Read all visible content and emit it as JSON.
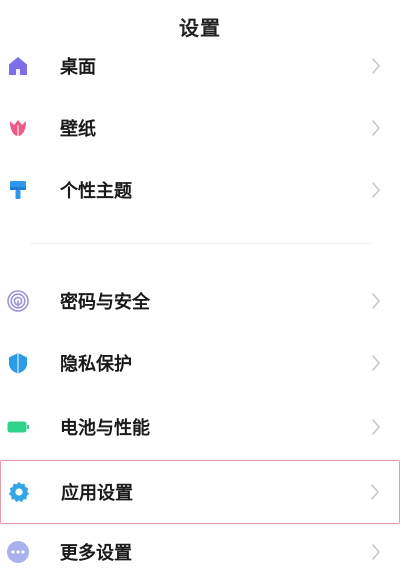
{
  "header": {
    "title": "设置"
  },
  "items": [
    {
      "label": "桌面",
      "icon": "home-icon",
      "color": "#7b6ee8"
    },
    {
      "label": "壁纸",
      "icon": "tulip-icon",
      "color": "#ee5a86"
    },
    {
      "label": "个性主题",
      "icon": "paint-brush-icon",
      "color": "#2f96ee"
    },
    {
      "label": "密码与安全",
      "icon": "fingerprint-icon",
      "color": "#9a95d8"
    },
    {
      "label": "隐私保护",
      "icon": "shield-icon",
      "color": "#2a9ce6"
    },
    {
      "label": "电池与性能",
      "icon": "battery-icon",
      "color": "#2fd28b"
    },
    {
      "label": "应用设置",
      "icon": "gear-icon",
      "color": "#33a7e6"
    },
    {
      "label": "更多设置",
      "icon": "more-dots-icon",
      "color": "#a9b0ee"
    }
  ],
  "colors": {
    "chevron": "#c8c8c8",
    "highlight_border": "#e0a0a8"
  }
}
